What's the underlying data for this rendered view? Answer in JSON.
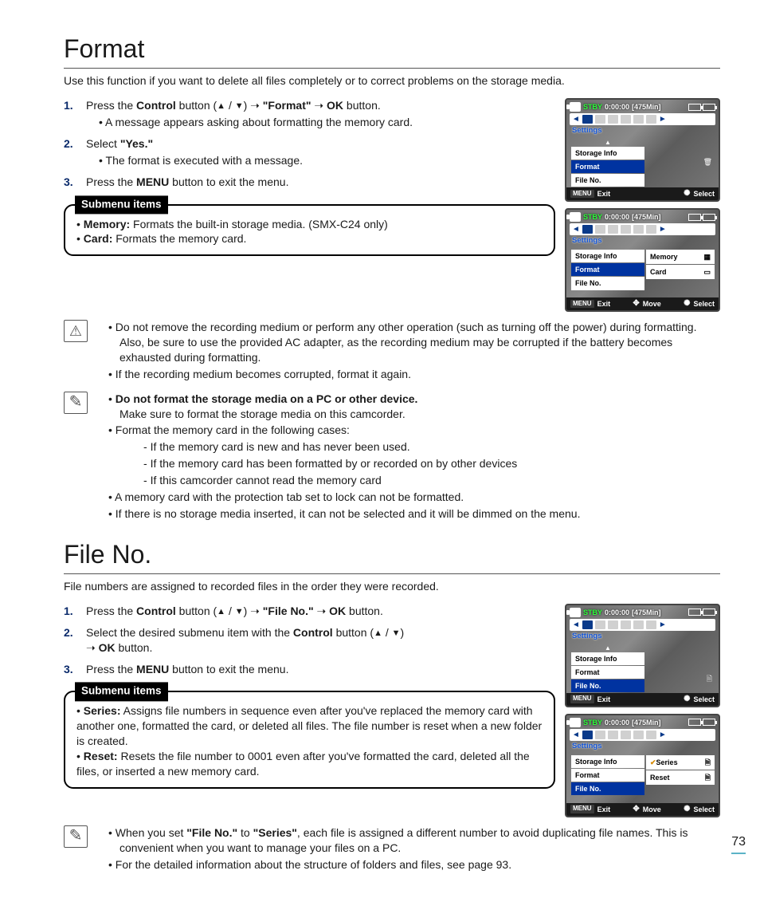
{
  "page_number": "73",
  "format": {
    "title": "Format",
    "intro": "Use this function if you want to delete all files completely or to correct problems on the storage media.",
    "steps": [
      {
        "num": "1.",
        "pre": "Press the ",
        "b1": "Control",
        "mid1": " button (",
        "up": "▲",
        "slash": " / ",
        "dn": "▼",
        "mid2": ") ➝ ",
        "b2": "\"Format\"",
        "mid3": " ➝ ",
        "b3": "OK",
        "post": " button.",
        "sub": [
          "A message appears asking about formatting the memory card."
        ]
      },
      {
        "num": "2.",
        "pre": "Select ",
        "b1": "\"Yes.\"",
        "post": "",
        "sub": [
          "The format is executed with a message."
        ]
      },
      {
        "num": "3.",
        "pre": " Press the ",
        "b1": "MENU",
        "post": " button to exit the menu.",
        "sub": []
      }
    ],
    "submenu_label": "Submenu items",
    "submenu": [
      {
        "b": "Memory:",
        "t": " Formats the built-in storage media. (SMX-C24 only)"
      },
      {
        "b": "Card:",
        "t": " Formats the memory card."
      }
    ],
    "warning": [
      "Do not remove the recording medium or perform any other operation (such as turning off the power) during formatting. Also, be sure to use the provided AC adapter, as the recording medium may be corrupted if the battery becomes exhausted during formatting.",
      "If the recording medium becomes corrupted, format it again."
    ],
    "notes": {
      "lead_bold": "Do not format the storage media on a PC or other device.",
      "lead_sub": "Make sure to format the storage media on this camcorder.",
      "items": [
        "Format the memory card in the following cases:",
        "A memory card with the protection tab set to lock can not be formatted.",
        "If there is no storage media inserted, it can not be selected and it will be dimmed on the menu."
      ],
      "subitems": [
        "If the memory card is new and has never been used.",
        "If the memory card has been formatted by or recorded on by other devices",
        "If this camcorder cannot read the memory card"
      ]
    }
  },
  "fileno": {
    "title": "File No.",
    "intro": "File numbers are assigned to recorded files in the order they were recorded.",
    "steps": [
      {
        "num": "1.",
        "pre": " Press the ",
        "b1": "Control",
        "mid1": " button (",
        "up": "▲",
        "slash": " / ",
        "dn": "▼",
        "mid2": ") ➝ ",
        "b2": "\"File No.\"",
        "mid3": " ➝ ",
        "b3": "OK",
        "post": " button.",
        "sub": []
      },
      {
        "num": "2.",
        "pre": " Select the desired submenu item with the ",
        "b1": "Control",
        "mid1": " button (",
        "up": "▲",
        "slash": " / ",
        "dn": "▼",
        "mid2": ") ",
        "post2": "➝ ",
        "b3": "OK",
        "post": " button.",
        "sub": []
      },
      {
        "num": "3.",
        "pre": " Press the ",
        "b1": "MENU",
        "post": " button to exit the menu.",
        "sub": []
      }
    ],
    "submenu_label": "Submenu items",
    "submenu": [
      {
        "b": "Series:",
        "t": " Assigns file numbers in sequence even after you've replaced the memory card with another one, formatted the card, or deleted all files. The file number is reset when a new folder is created."
      },
      {
        "b": "Reset:",
        "t": " Resets the file number to 0001 even after you've formatted the card, deleted all the files, or inserted a new memory card."
      }
    ],
    "notes": [
      {
        "pre": "When you set ",
        "b1": "\"File No.\"",
        "mid": " to ",
        "b2": "\"Series\"",
        "post": ", each file is assigned a different number to avoid duplicating file names. This is convenient when you want to manage your files on a PC."
      },
      {
        "plain": "For the detailed information about the structure of folders and files, see page 93."
      }
    ]
  },
  "lcd": {
    "stby": "STBY",
    "time": "0:00:00",
    "remain": "[475Min]",
    "settings": "Settings",
    "menu": {
      "storage": "Storage Info",
      "format": "Format",
      "fileno": "File No."
    },
    "popup": {
      "memory": "Memory",
      "card": "Card",
      "series": "Series",
      "reset": "Reset"
    },
    "bot": {
      "menu": "MENU",
      "exit": "Exit",
      "select": "Select",
      "move": "Move"
    }
  }
}
